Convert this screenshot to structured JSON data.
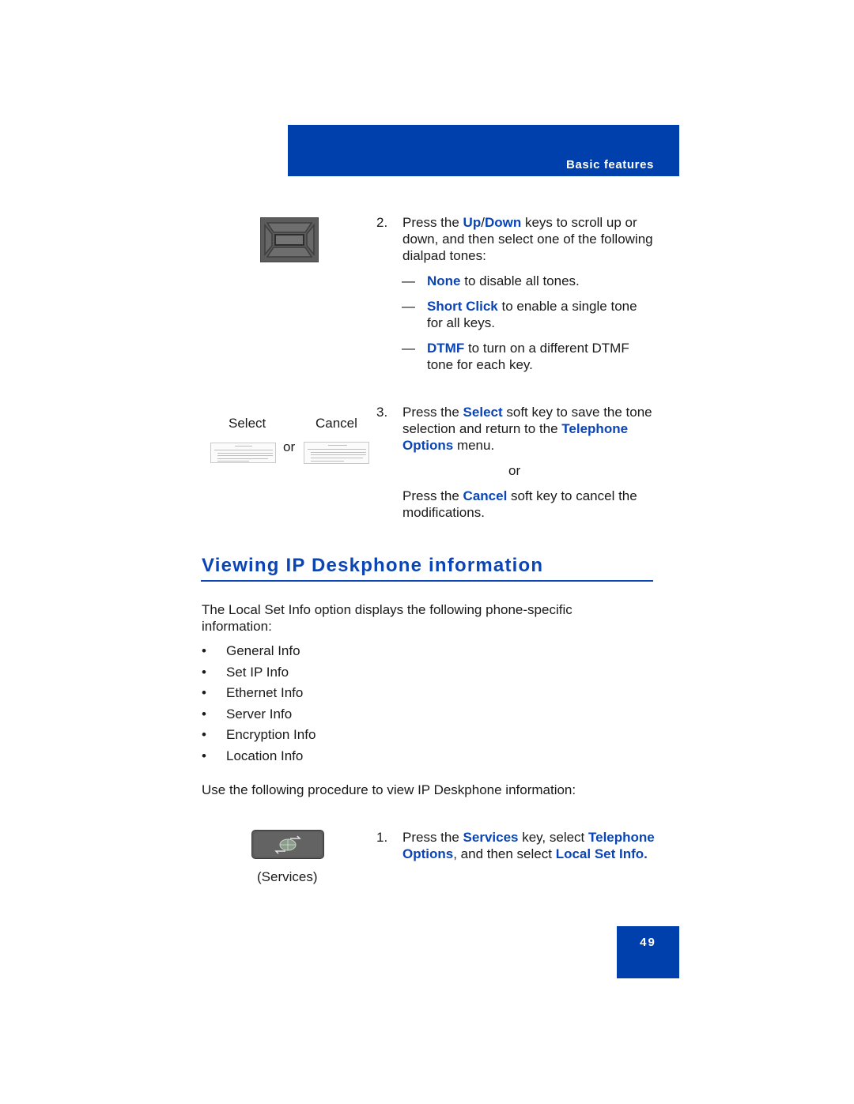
{
  "header": {
    "section_label": "Basic features",
    "color": "#0040ad"
  },
  "step2": {
    "number": "2.",
    "pre": "Press the ",
    "key_up": "Up",
    "slash": "/",
    "key_down": "Down",
    "post": " keys to scroll up or down, and then select one of the following dialpad tones:",
    "options": [
      {
        "dash": "—",
        "term": "None",
        "desc": " to disable all tones."
      },
      {
        "dash": "—",
        "term": "Short Click",
        "desc": " to enable a single tone for all keys."
      },
      {
        "dash": "—",
        "term": "DTMF",
        "desc": " to turn on a different DTMF tone for each key."
      }
    ],
    "nav_key_icon": "navigation-cluster-icon"
  },
  "softkeys": {
    "select_label": "Select",
    "cancel_label": "Cancel",
    "or_label": "or",
    "select_icon": "warning-thumbnail-icon",
    "cancel_icon": "warning-thumbnail-icon"
  },
  "step3": {
    "number": "3.",
    "pre": "Press the ",
    "key": "Select",
    "mid": " soft key to save the tone selection and return to the ",
    "menu": "Telephone Options",
    "post": " menu.",
    "or": "or",
    "alt_pre": "Press the ",
    "alt_key": "Cancel",
    "alt_post": " soft key to cancel the modifications."
  },
  "section": {
    "heading": "Viewing IP Deskphone information",
    "intro": "The Local Set Info option displays the following phone-specific information:",
    "bullet_char": "•",
    "items": [
      "General Info",
      "Set IP Info",
      "Ethernet Info",
      "Server Info",
      "Encryption Info",
      "Location Info"
    ],
    "procedure_intro": "Use the following procedure to view IP Deskphone information:"
  },
  "step1": {
    "number": "1.",
    "pre": "Press the ",
    "key": "Services",
    "mid": " key, select ",
    "menu": "Telephone Options",
    "mid2": ", and then select ",
    "item": "Local Set Info.",
    "key_caption": "(Services)",
    "key_icon": "services-globe-icon"
  },
  "footer": {
    "page_number": "49"
  }
}
